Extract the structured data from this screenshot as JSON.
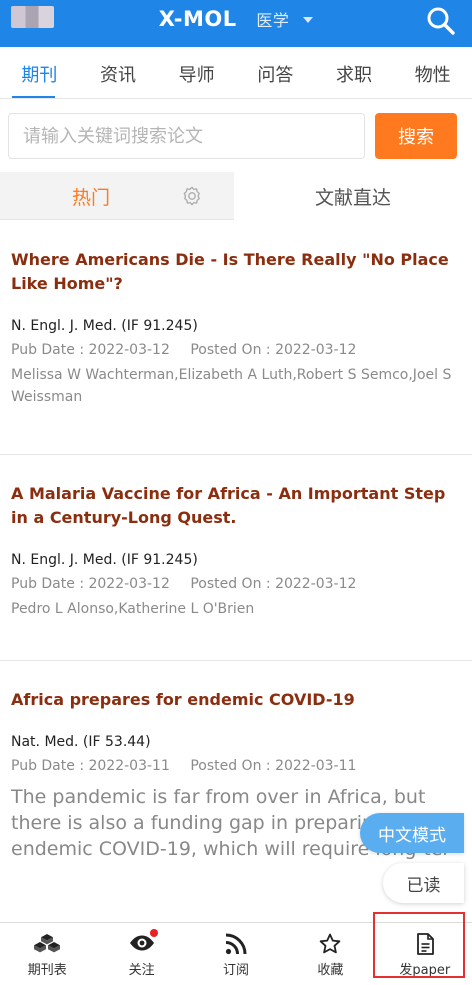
{
  "header": {
    "title": "X-MOL",
    "category": "医学"
  },
  "tabs": [
    {
      "label": "期刊"
    },
    {
      "label": "资讯"
    },
    {
      "label": "导师"
    },
    {
      "label": "问答"
    },
    {
      "label": "求职"
    },
    {
      "label": "物性"
    }
  ],
  "search": {
    "placeholder": "请输入关键词搜索论文",
    "button_label": "搜索"
  },
  "subtabs": {
    "hot": "热门",
    "direct": "文献直达"
  },
  "articles": [
    {
      "title": "Where Americans Die - Is There Really \"No Place Like Home\"?",
      "journal": "N. Engl. J. Med. (IF 91.245)",
      "pub_date": "Pub Date : 2022-03-12",
      "posted_on": "Posted On : 2022-03-12",
      "authors": "Melissa W Wachterman,Elizabeth A Luth,Robert S Semco,Joel S Weissman"
    },
    {
      "title": "A Malaria Vaccine for Africa - An Important Step in a Century-Long Quest.",
      "journal": "N. Engl. J. Med. (IF 91.245)",
      "pub_date": "Pub Date : 2022-03-12",
      "posted_on": "Posted On : 2022-03-12",
      "authors": "Pedro L Alonso,Katherine L O'Brien"
    },
    {
      "title": "Africa prepares for endemic COVID-19",
      "journal": "Nat. Med. (IF 53.44)",
      "pub_date": "Pub Date : 2022-03-11",
      "posted_on": "Posted On : 2022-03-11",
      "abstract": "The pandemic is far from over in Africa, but there is also a funding gap in preparing for endemic COVID-19, which will require long-ter"
    }
  ],
  "floating": {
    "chinese_mode": "中文模式",
    "read": "已读"
  },
  "bottom_nav": [
    {
      "label": "期刊表",
      "icon": "journals-icon"
    },
    {
      "label": "关注",
      "icon": "eye-icon"
    },
    {
      "label": "订阅",
      "icon": "rss-icon"
    },
    {
      "label": "收藏",
      "icon": "star-icon"
    },
    {
      "label": "发paper",
      "icon": "document-icon"
    }
  ],
  "colors": {
    "header_bg": "#1f86e8",
    "accent_orange": "#ff7a1f",
    "title_red": "#8b2e10",
    "float_blue": "#5aaef0",
    "highlight_red": "#e53030"
  }
}
